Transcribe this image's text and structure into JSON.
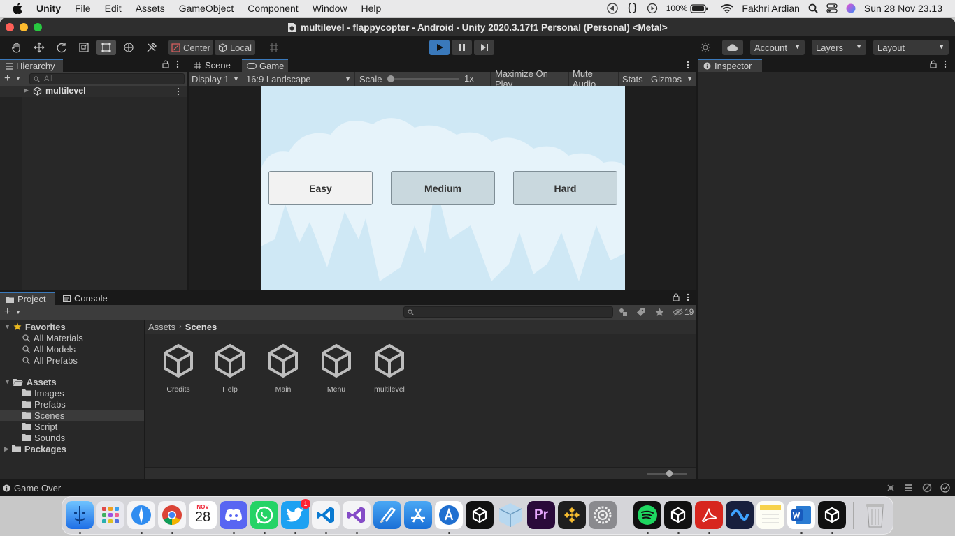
{
  "menubar": {
    "apple": "",
    "app_name": "Unity",
    "items": [
      "File",
      "Edit",
      "Assets",
      "GameObject",
      "Component",
      "Window",
      "Help"
    ],
    "braces": "{}",
    "battery": "100%",
    "user": "Fakhri Ardian",
    "clock": "Sun 28 Nov  23.13"
  },
  "window": {
    "title": "multilevel - flappycopter - Android - Unity 2020.3.17f1 Personal (Personal) <Metal>"
  },
  "toolbar": {
    "pivot_center": "Center",
    "pivot_local": "Local",
    "account": "Account",
    "layers": "Layers",
    "layout": "Layout"
  },
  "hierarchy": {
    "tab": "Hierarchy",
    "search_placeholder": "All",
    "scene_item": "multilevel"
  },
  "game_view": {
    "tab_scene": "Scene",
    "tab_game": "Game",
    "display": "Display 1",
    "aspect": "16:9 Landscape",
    "scale_label": "Scale",
    "scale_value": "1x",
    "maximize": "Maximize On Play",
    "mute": "Mute Audio",
    "stats": "Stats",
    "gizmos": "Gizmos",
    "buttons": [
      "Easy",
      "Medium",
      "Hard"
    ],
    "sky_color": "#cfe8f5",
    "cloud_color": "#e6f3fa"
  },
  "inspector": {
    "tab": "Inspector"
  },
  "project": {
    "tab_project": "Project",
    "tab_console": "Console",
    "hidden_count": "19",
    "favorites_label": "Favorites",
    "favorites": [
      "All Materials",
      "All Models",
      "All Prefabs"
    ],
    "assets_label": "Assets",
    "folders": [
      "Images",
      "Prefabs",
      "Scenes",
      "Script",
      "Sounds"
    ],
    "packages_label": "Packages",
    "breadcrumb_root": "Assets",
    "breadcrumb_current": "Scenes",
    "scene_assets": [
      "Credits",
      "Help",
      "Main",
      "Menu",
      "multilevel"
    ]
  },
  "status": {
    "message": "Game Over"
  },
  "dock": {
    "calendar_month": "NOV",
    "calendar_day": "28",
    "twitter_badge": "1",
    "premiere": "Pr"
  }
}
